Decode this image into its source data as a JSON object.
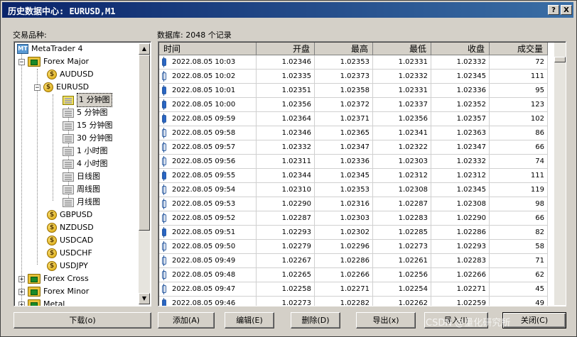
{
  "window": {
    "title": "历史数据中心: EURUSD,M1",
    "help_btn": "?",
    "close_btn": "X"
  },
  "labels": {
    "symbols": "交易品种:",
    "database": "数据库: 2048 个记录"
  },
  "tree": {
    "root": "MetaTrader 4",
    "groups": [
      {
        "name": "Forex Major"
      },
      {
        "name": "Forex Cross"
      },
      {
        "name": "Forex Minor"
      },
      {
        "name": "Metal"
      }
    ],
    "symbols": [
      "AUDUSD",
      "EURUSD",
      "GBPUSD",
      "NZDUSD",
      "USDCAD",
      "USDCHF",
      "USDJPY"
    ],
    "timeframes": [
      "1 分钟图",
      "5 分钟图",
      "15 分钟图",
      "30 分钟图",
      "1 小时图",
      "4 小时图",
      "日线图",
      "周线图",
      "月线图"
    ],
    "selected_timeframe": "1 分钟图"
  },
  "grid": {
    "columns": [
      "时间",
      "开盘",
      "最高",
      "最低",
      "收盘",
      "成交量"
    ],
    "rows": [
      [
        "2022.08.05 10:03",
        "1.02346",
        "1.02353",
        "1.02331",
        "1.02332",
        "72",
        "f"
      ],
      [
        "2022.08.05 10:02",
        "1.02335",
        "1.02373",
        "1.02332",
        "1.02345",
        "111",
        "h"
      ],
      [
        "2022.08.05 10:01",
        "1.02351",
        "1.02358",
        "1.02331",
        "1.02336",
        "95",
        "f"
      ],
      [
        "2022.08.05 10:00",
        "1.02356",
        "1.02372",
        "1.02337",
        "1.02352",
        "123",
        "f"
      ],
      [
        "2022.08.05 09:59",
        "1.02364",
        "1.02371",
        "1.02356",
        "1.02357",
        "102",
        "f"
      ],
      [
        "2022.08.05 09:58",
        "1.02346",
        "1.02365",
        "1.02341",
        "1.02363",
        "86",
        "h"
      ],
      [
        "2022.08.05 09:57",
        "1.02332",
        "1.02347",
        "1.02322",
        "1.02347",
        "66",
        "h"
      ],
      [
        "2022.08.05 09:56",
        "1.02311",
        "1.02336",
        "1.02303",
        "1.02332",
        "74",
        "h"
      ],
      [
        "2022.08.05 09:55",
        "1.02344",
        "1.02345",
        "1.02312",
        "1.02312",
        "111",
        "f"
      ],
      [
        "2022.08.05 09:54",
        "1.02310",
        "1.02353",
        "1.02308",
        "1.02345",
        "119",
        "h"
      ],
      [
        "2022.08.05 09:53",
        "1.02290",
        "1.02316",
        "1.02287",
        "1.02308",
        "98",
        "h"
      ],
      [
        "2022.08.05 09:52",
        "1.02287",
        "1.02303",
        "1.02283",
        "1.02290",
        "66",
        "h"
      ],
      [
        "2022.08.05 09:51",
        "1.02293",
        "1.02302",
        "1.02285",
        "1.02286",
        "82",
        "f"
      ],
      [
        "2022.08.05 09:50",
        "1.02279",
        "1.02296",
        "1.02273",
        "1.02293",
        "58",
        "h"
      ],
      [
        "2022.08.05 09:49",
        "1.02267",
        "1.02286",
        "1.02261",
        "1.02283",
        "71",
        "h"
      ],
      [
        "2022.08.05 09:48",
        "1.02265",
        "1.02266",
        "1.02256",
        "1.02266",
        "62",
        "h"
      ],
      [
        "2022.08.05 09:47",
        "1.02258",
        "1.02271",
        "1.02254",
        "1.02271",
        "45",
        "h"
      ],
      [
        "2022.08.05 09:46",
        "1.02273",
        "1.02282",
        "1.02262",
        "1.02259",
        "49",
        "f"
      ]
    ]
  },
  "buttons": {
    "download": "下载(o)",
    "add": "添加(A)",
    "edit": "编辑(E)",
    "delete": "删除(D)",
    "export": "导出(x)",
    "import": "导入(I)",
    "close": "关闭(C)"
  },
  "watermark": "CSDN @量化研究所"
}
